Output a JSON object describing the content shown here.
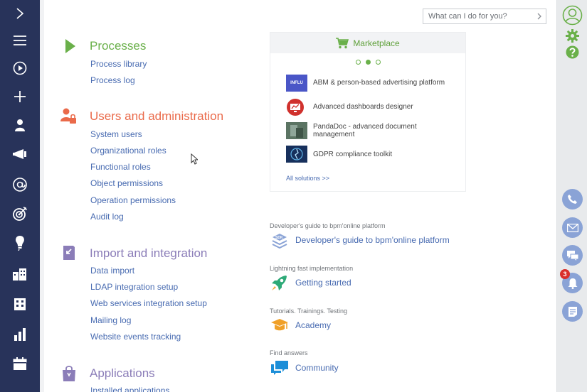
{
  "nav": {
    "items": [
      {
        "name": "expand-arrow-icon"
      },
      {
        "name": "menu-icon"
      },
      {
        "name": "play-icon"
      },
      {
        "name": "plus-icon"
      },
      {
        "name": "person-icon"
      },
      {
        "name": "megaphone-icon"
      },
      {
        "name": "at-icon"
      },
      {
        "name": "target-icon"
      },
      {
        "name": "lightbulb-icon"
      },
      {
        "name": "buildings-icon"
      },
      {
        "name": "building-icon"
      },
      {
        "name": "bar-chart-icon"
      },
      {
        "name": "calendar-icon"
      }
    ]
  },
  "search": {
    "placeholder": "What can I do for you?",
    "icon": "chevron-right-icon"
  },
  "sections": {
    "processes": {
      "title": "Processes",
      "color": "#6ab04a",
      "links": [
        "Process library",
        "Process log"
      ]
    },
    "users": {
      "title": "Users and administration",
      "color": "#ea6a4a",
      "links": [
        "System users",
        "Organizational roles",
        "Functional roles",
        "Object permissions",
        "Operation permissions",
        "Audit log"
      ]
    },
    "import": {
      "title": "Import and integration",
      "color": "#8b7db8",
      "links": [
        "Data import",
        "LDAP integration setup",
        "Web services integration setup",
        "Mailing log",
        "Website events tracking"
      ]
    },
    "applications": {
      "title": "Applications",
      "color": "#8b7db8",
      "links": [
        "Installed applications"
      ]
    }
  },
  "marketplace": {
    "title": "Marketplace",
    "accent": "#6ab04a",
    "pager_active": 1,
    "pager_count": 3,
    "solutions": [
      {
        "name": "ABM & person-based advertising platform",
        "thumb_text": "INFLU"
      },
      {
        "name": "Advanced dashboards designer"
      },
      {
        "name": "PandaDoc - advanced document management"
      },
      {
        "name": "GDPR compliance toolkit"
      }
    ],
    "all_link": "All solutions >>"
  },
  "guides": [
    {
      "caption": "Developer's guide to bpm'online platform",
      "link": "Developer's guide to bpm'online platform",
      "icon": "sdk-icon"
    },
    {
      "caption": "Lightning fast implementation",
      "link": "Getting started",
      "icon": "rocket-icon"
    },
    {
      "caption": "Tutorials. Trainings. Testing",
      "link": "Academy",
      "icon": "graduation-cap-icon"
    },
    {
      "caption": "Find answers",
      "link": "Community",
      "icon": "chat-bubbles-icon"
    }
  ],
  "rightbar": {
    "notifications_count": "3",
    "buttons": [
      "phone-icon",
      "email-icon",
      "chat-icon",
      "bell-icon",
      "feed-icon"
    ]
  }
}
